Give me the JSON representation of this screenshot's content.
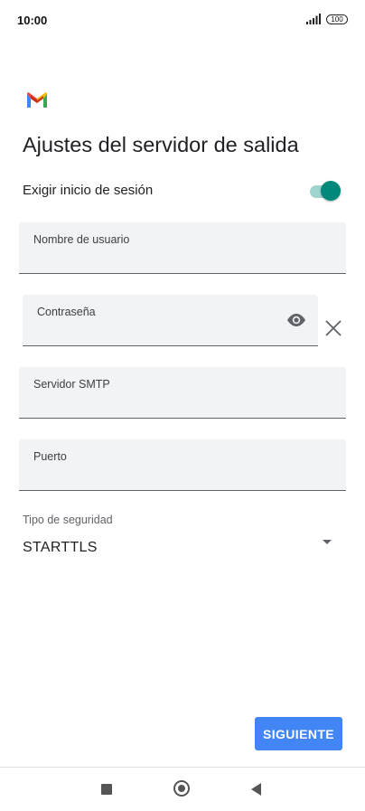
{
  "status_bar": {
    "time": "10:00",
    "battery": "100",
    "signal_icon": "signal-icon",
    "battery_icon": "battery-icon"
  },
  "app": {
    "logo_icon": "gmail-logo-icon",
    "brand_colors": [
      "#ea4335",
      "#4285f4",
      "#34a853",
      "#fbbc04"
    ]
  },
  "page": {
    "title": "Ajustes del servidor de salida"
  },
  "login_required": {
    "label": "Exigir inicio de sesión",
    "enabled": true,
    "accent": "#00897b"
  },
  "fields": {
    "username": {
      "label": "Nombre de usuario",
      "value": ""
    },
    "password": {
      "label": "Contraseña",
      "value": "",
      "visibility_icon": "eye-icon",
      "clear_icon": "close-icon"
    },
    "smtp_server": {
      "label": "Servidor SMTP",
      "value": ""
    },
    "port": {
      "label": "Puerto",
      "value": ""
    }
  },
  "security": {
    "label": "Tipo de seguridad",
    "value": "STARTTLS",
    "dropdown_icon": "dropdown-arrow-icon"
  },
  "actions": {
    "next_label": "SIGUIENTE",
    "button_color": "#4285f4"
  },
  "nav": {
    "recents_icon": "square-icon",
    "home_icon": "circle-icon",
    "back_icon": "back-triangle-icon"
  }
}
